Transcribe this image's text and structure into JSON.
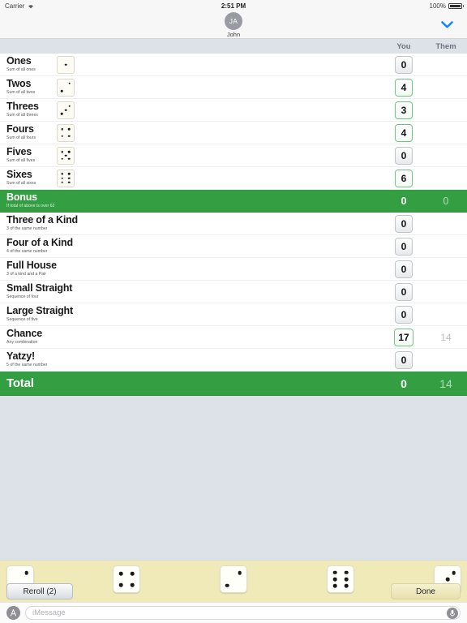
{
  "status_bar": {
    "carrier": "Carrier",
    "wifi_icon": "wifi-icon",
    "time": "2:51 PM",
    "battery_percent": "100%",
    "battery_icon": "battery-full-icon"
  },
  "nav_bar": {
    "avatar_initials": "JA",
    "contact_name": "John",
    "collapse_icon": "chevron-down-icon",
    "accent_color": "#0b84ff"
  },
  "scoreboard": {
    "column_headers": {
      "you": "You",
      "them": "Them"
    },
    "green_color": "#349e42",
    "available_border_color": "#6ec77d",
    "rows": [
      {
        "label": "Ones",
        "sub": "Sum of all ones",
        "die": 1,
        "you": "0",
        "you_available": false,
        "them": ""
      },
      {
        "label": "Twos",
        "sub": "Sum of all twos",
        "die": 2,
        "you": "4",
        "you_available": true,
        "them": ""
      },
      {
        "label": "Threes",
        "sub": "Sum of all threes",
        "die": 3,
        "you": "3",
        "you_available": true,
        "them": ""
      },
      {
        "label": "Fours",
        "sub": "Sum of all fours",
        "die": 4,
        "you": "4",
        "you_available": true,
        "them": ""
      },
      {
        "label": "Fives",
        "sub": "Sum of all fives",
        "die": 5,
        "you": "0",
        "you_available": false,
        "them": ""
      },
      {
        "label": "Sixes",
        "sub": "Sum of all sixes",
        "die": 6,
        "you": "6",
        "you_available": true,
        "them": ""
      },
      {
        "label": "Bonus",
        "sub": "If total of above is over 62",
        "die": 0,
        "you": "0",
        "you_available": false,
        "them": "0",
        "green": true
      },
      {
        "label": "Three of a Kind",
        "sub": "3 of the same number",
        "die": 0,
        "you": "0",
        "you_available": false,
        "them": ""
      },
      {
        "label": "Four of a Kind",
        "sub": "4 of the same number",
        "die": 0,
        "you": "0",
        "you_available": false,
        "them": ""
      },
      {
        "label": "Full House",
        "sub": "3 of a kind and a Pair",
        "die": 0,
        "you": "0",
        "you_available": false,
        "them": ""
      },
      {
        "label": "Small Straight",
        "sub": "Sequence of four",
        "die": 0,
        "you": "0",
        "you_available": false,
        "them": ""
      },
      {
        "label": "Large Straight",
        "sub": "Sequence of five",
        "die": 0,
        "you": "0",
        "you_available": false,
        "them": ""
      },
      {
        "label": "Chance",
        "sub": "Any combination",
        "die": 0,
        "you": "17",
        "you_available": true,
        "them": "14"
      },
      {
        "label": "Yatzy!",
        "sub": "5 of the same number",
        "die": 0,
        "you": "0",
        "you_available": false,
        "them": ""
      },
      {
        "label": "Total",
        "sub": "",
        "die": 0,
        "you": "0",
        "you_available": false,
        "them": "14",
        "green": true,
        "total": true
      }
    ]
  },
  "tray": {
    "background_color": "#f0e9b8",
    "dice": [
      2,
      4,
      2,
      6,
      3
    ],
    "reroll_label": "Reroll (2)",
    "done_label": "Done"
  },
  "message_bar": {
    "app_icon": "app-store-icon",
    "placeholder": "iMessage",
    "mic_icon": "microphone-icon"
  }
}
